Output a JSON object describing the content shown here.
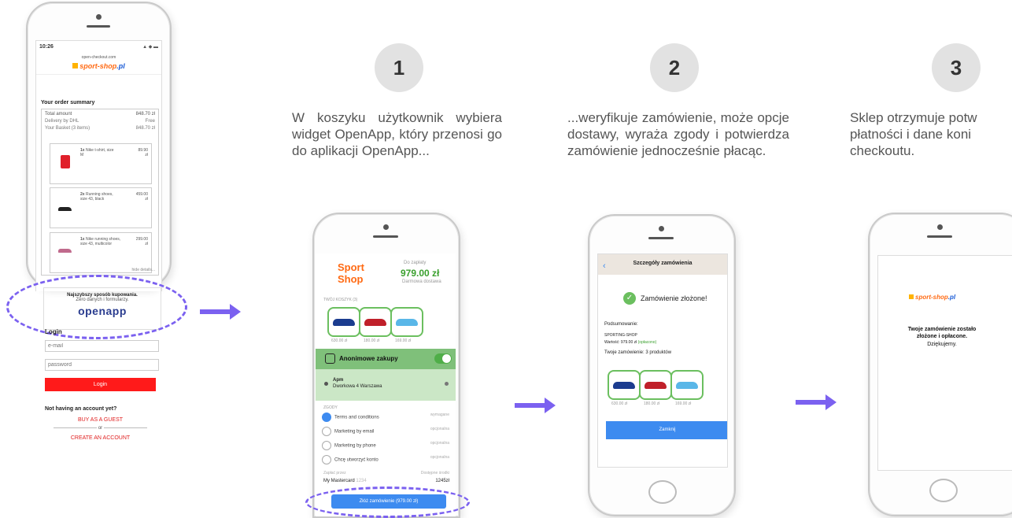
{
  "colors": {
    "accent": "#7b61f0",
    "login": "#ff1a1a",
    "green": "#6bbf5f",
    "blue": "#3d8bf0",
    "brand": "#ff6a13"
  },
  "steps": [
    {
      "number": "1",
      "text": "W koszyku użytkownik wybiera widget OpenApp, który przenosi go do aplikacji OpenApp..."
    },
    {
      "number": "2",
      "text": "...weryfikuje zamówienie, może opcje dostawy, wyraża zgody i potwierdza zamówienie jednocześnie płacąc."
    },
    {
      "number": "3",
      "text": "Sklep otrzymuje potw płatności i dane koni checkoutu."
    }
  ],
  "phone1": {
    "time": "10:26",
    "status_icons": "▲ ◆ ▬",
    "url": "open-checkout.com",
    "brand": "sport-shop",
    "summary_title": "Your order summary",
    "totals": [
      [
        "Total amount",
        "848.70 zł"
      ],
      [
        "Delivery by DHL",
        "Free"
      ],
      [
        "Your Basket (3 items)",
        "848.70 zł"
      ]
    ],
    "products": [
      {
        "name_bold": "1x",
        "name": "Nike t-shirt, size M",
        "price": "89.90",
        "cur": "zł"
      },
      {
        "name_bold": "2x",
        "name": "Running shoes, size 43, black",
        "price": "459.00",
        "cur": "zł"
      },
      {
        "name_bold": "1x",
        "name": "Nike running shoes, size 43, multicolor",
        "price": "299.00",
        "cur": "zł"
      }
    ],
    "hide_details": "hide details...",
    "widget_title": "Najszybszy sposób kupowania.",
    "widget_sub": "Zero danych i formularzy.",
    "widget_logo": "openapp",
    "login_label": "Login",
    "email_ph": "e-mail",
    "password_ph": "password",
    "login_btn": "Login",
    "no_account": "Not having an account yet?",
    "guest": "BUY AS A GUEST",
    "or": "or",
    "create": "CREATE AN ACCOUNT"
  },
  "phone2": {
    "shop": "Sport\nShop",
    "pay_label": "Do zapłaty",
    "amount": "979.00 zł",
    "free": "Darmowa dostawa",
    "basket_label": "TWÓJ KOSZYK (3)",
    "prices": [
      "630.00 zł",
      "180.00 zł",
      "169.00 zł"
    ],
    "anon": "Anonimowe zakupy",
    "apm_title": "Apm",
    "apm_addr": "Dworkowa 4 Warszawa",
    "consent_label": "ZGODY",
    "consents": [
      [
        "Terms and conditions",
        "wymagane"
      ],
      [
        "Marketing by email",
        "opcjonalna"
      ],
      [
        "Marketing by phone",
        "opcjonalna"
      ],
      [
        "Chcę utworzyć konto",
        "opcjonalna"
      ]
    ],
    "pay_by": "Zapłać przez",
    "card_label": "Dostępne środki",
    "card": "My Mastercard",
    "card_num": "1234",
    "balance": "1245zł",
    "button": "Złóż zamówienie (979.00 zł)"
  },
  "phone3": {
    "header": "Szczegóły zamówienia",
    "placed": "Zamówienie złożone!",
    "summary": "Podsumowanie:",
    "shop": "SPORTING-SHOP",
    "value_label": "Wartość: 979.00 zł",
    "paid": "(opłacono)",
    "order": "Twoje zamówienie: 3 produktów",
    "prices": [
      "630.00 zł",
      "180.00 zł",
      "169.00 zł"
    ],
    "close": "Zamknij"
  },
  "phone4": {
    "brand": "sport-shop",
    "line1": "Twoje zamówienie zostało",
    "line2": "złożone i opłacone.",
    "line3": "Dziękujemy."
  }
}
